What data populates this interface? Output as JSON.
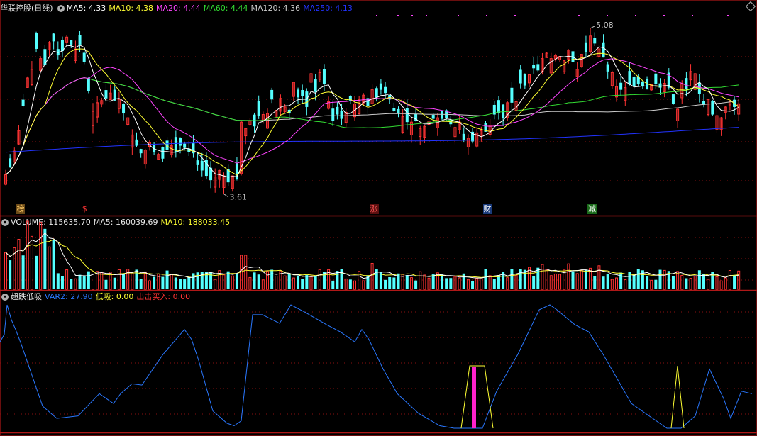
{
  "price_panel": {
    "title": "华联控股(日线)",
    "mas": [
      {
        "label": "MA5: 4.33",
        "color": "#ffffff"
      },
      {
        "label": "MA10: 4.38",
        "color": "#ffff33"
      },
      {
        "label": "MA20: 4.44",
        "color": "#ff44ff"
      },
      {
        "label": "MA60: 4.44",
        "color": "#33dd33"
      },
      {
        "label": "MA120: 4.36",
        "color": "#cccccc"
      },
      {
        "label": "MA250: 4.13",
        "color": "#2233ff"
      }
    ],
    "high_label": "5.08",
    "low_label": "3.61",
    "signal_tags": [
      {
        "text": "榜",
        "color": "#ffcc66",
        "bg": "#6b4a18",
        "idx": 3
      },
      {
        "text": "$",
        "color": "#ff3333",
        "bg": "#000000",
        "idx": 18
      },
      {
        "text": "涨",
        "color": "#ff5555",
        "bg": "#5a1010",
        "idx": 84
      },
      {
        "text": "财",
        "color": "#ffffff",
        "bg": "#1a3a7a",
        "idx": 110
      },
      {
        "text": "减",
        "color": "#ffffff",
        "bg": "#1a6a1a",
        "idx": 134
      }
    ]
  },
  "volume_panel": {
    "title": "VOLUME: 115635.70",
    "ma5": "MA5: 160039.69",
    "ma10": "MA10: 188033.45"
  },
  "indicator_panel": {
    "title": "超跌低吸",
    "var2": "VAR2: 27.90",
    "dixi": "低吸: 0.00",
    "buy": "出击买入: 0.00"
  },
  "colors": {
    "up": "#ff3333",
    "down": "#54ffff",
    "ma5": "#ffffff",
    "ma10": "#ffff33",
    "ma20": "#ff44ff",
    "ma60": "#33dd33",
    "ma120": "#cccccc",
    "ma250": "#2233ff",
    "var2": "#2a78ff",
    "grid": "#8a1010"
  },
  "chart_data": {
    "type": "candlestick",
    "price_range": [
      3.45,
      5.15
    ],
    "closes": [
      3.71,
      3.78,
      3.93,
      4.12,
      4.35,
      4.61,
      4.69,
      4.88,
      4.79,
      4.73,
      4.94,
      4.95,
      4.82,
      4.86,
      4.99,
      4.92,
      4.88,
      4.92,
      4.76,
      4.49,
      4.3,
      4.38,
      4.4,
      4.42,
      4.47,
      4.4,
      4.41,
      4.28,
      4.24,
      4.08,
      3.98,
      3.91,
      3.94,
      4.01,
      3.92,
      3.9,
      3.86,
      3.94,
      3.98,
      3.92,
      3.98,
      3.96,
      3.92,
      3.91,
      3.8,
      3.75,
      3.7,
      3.66,
      3.69,
      3.75,
      3.7,
      3.64,
      3.7,
      3.67,
      4.2,
      4.14,
      4.21,
      4.16,
      4.26,
      4.27,
      4.28,
      4.41,
      4.31,
      4.42,
      4.34,
      4.28,
      4.57,
      4.43,
      4.44,
      4.34,
      4.65,
      4.48,
      4.66,
      4.55,
      4.39,
      4.21,
      4.27,
      4.23,
      4.29,
      4.4,
      4.37,
      4.41,
      4.45,
      4.35,
      4.5,
      4.43,
      4.5,
      4.47,
      4.41,
      4.3,
      4.28,
      4.25,
      4.2,
      4.2,
      4.21,
      4.14,
      4.16,
      4.21,
      4.23,
      4.24,
      4.23,
      4.24,
      4.18,
      4.15,
      4.2,
      4.03,
      4.05,
      4.02,
      4.1,
      4.12,
      4.11,
      4.17,
      4.27,
      4.28,
      4.24,
      4.38,
      4.38,
      4.39,
      4.56,
      4.54,
      4.64,
      4.7,
      4.68,
      4.79,
      4.84,
      4.79,
      4.82,
      4.81,
      4.77,
      4.87,
      4.76,
      4.69,
      4.83,
      4.85,
      5.0,
      4.93,
      4.88,
      4.8,
      4.67,
      4.66,
      4.53,
      4.5,
      4.52,
      4.55,
      4.53,
      4.55,
      4.53,
      4.51,
      4.55,
      4.55,
      4.52,
      4.56,
      4.52,
      4.37,
      4.32,
      4.56,
      4.51,
      4.67,
      4.65,
      4.46,
      4.36,
      4.41,
      4.27,
      4.26,
      4.24,
      4.34,
      4.39,
      4.34,
      4.37
    ]
  }
}
